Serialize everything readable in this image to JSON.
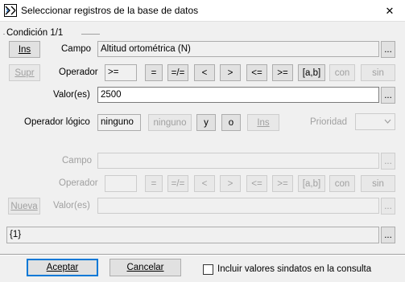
{
  "window": {
    "title": "Seleccionar registros de la base de datos",
    "close_label": "✕"
  },
  "group": {
    "label": "Condición 1/1"
  },
  "condition1": {
    "ins_label": "Ins",
    "supr_label": "Supr",
    "campo_label": "Campo",
    "campo_value": "Altitud ortométrica (N)",
    "operador_label": "Operador",
    "operador_value": ">=",
    "valor_label": "Valor(es)",
    "valor_value": "2500",
    "browse_label": "...",
    "operators": [
      "=",
      "=/=",
      "<",
      ">",
      "<=",
      ">=",
      "[a,b]",
      "con",
      "sin"
    ]
  },
  "logic": {
    "label": "Operador lógico",
    "value": "ninguno",
    "ninguno_label": "ninguno",
    "y_label": "y",
    "o_label": "o",
    "ins_label": "Ins",
    "prioridad_label": "Prioridad"
  },
  "condition2": {
    "campo_label": "Campo",
    "operador_label": "Operador",
    "valor_label": "Valor(es)",
    "nueva_label": "Nueva",
    "browse_label": "...",
    "operators": [
      "=",
      "=/=",
      "<",
      ">",
      "<=",
      ">=",
      "[a,b]",
      "con",
      "sin"
    ]
  },
  "expression": {
    "value": "{1}",
    "browse_label": "..."
  },
  "footer": {
    "accept_label": "Aceptar",
    "cancel_label": "Cancelar",
    "include_label": "Incluir valores sindatos en la consulta",
    "include_checked": false
  }
}
